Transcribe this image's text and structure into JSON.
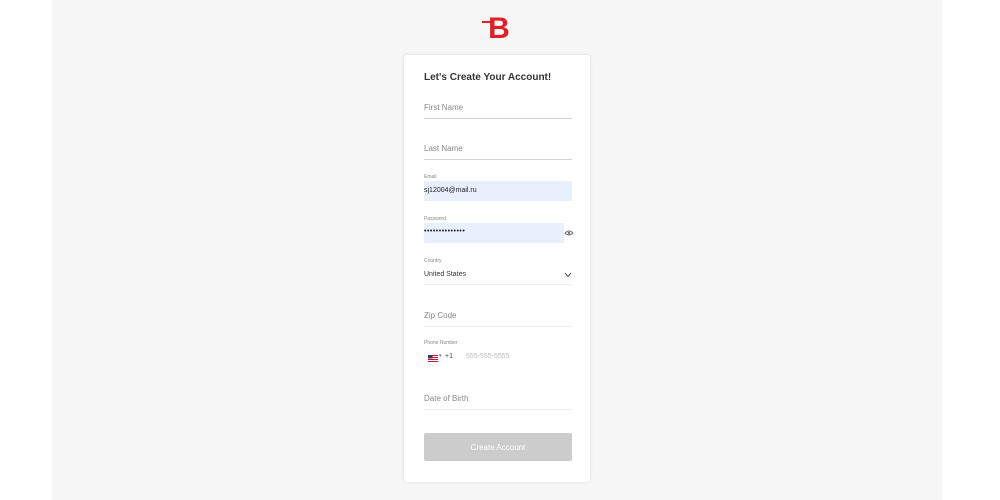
{
  "brand": {
    "logo_letter": "B",
    "color": "#e01f26"
  },
  "form": {
    "title": "Let's Create Your Account!",
    "first_name": {
      "placeholder": "First Name"
    },
    "last_name": {
      "placeholder": "Last Name"
    },
    "email": {
      "label": "Email",
      "value": "sj12004@mail.ru"
    },
    "password": {
      "label": "Password",
      "value": "••••••••••••••"
    },
    "country": {
      "label": "Country",
      "value": "United States"
    },
    "zip": {
      "placeholder": "Zip Code"
    },
    "phone": {
      "label": "Phone Number",
      "dial_code": "+1",
      "placeholder": "555-555-5555"
    },
    "dob": {
      "placeholder": "Date of Birth"
    },
    "submit_label": "Create Account"
  },
  "colors": {
    "background": "#f6f6f6",
    "autofill": "#e8f0fe",
    "button_disabled": "#cccccc"
  }
}
